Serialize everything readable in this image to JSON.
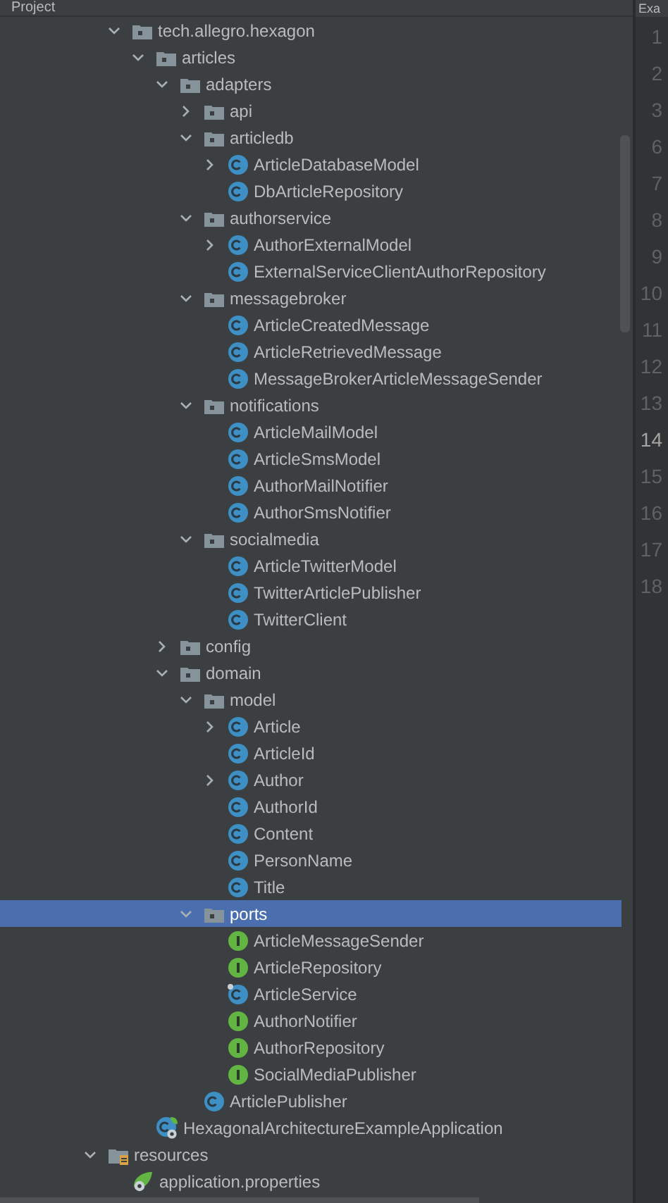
{
  "panel": {
    "title": "Project"
  },
  "editor_tab": {
    "label": "Exa"
  },
  "source_tree": [
    {
      "label": "tech.allegro.hexagon",
      "kind": "package",
      "expanded": true,
      "selected": false,
      "children": [
        {
          "label": "articles",
          "kind": "package",
          "expanded": true,
          "selected": false,
          "children": [
            {
              "label": "adapters",
              "kind": "package",
              "expanded": true,
              "selected": false,
              "children": [
                {
                  "label": "api",
                  "kind": "package",
                  "expanded": false,
                  "selected": false
                },
                {
                  "label": "articledb",
                  "kind": "package",
                  "expanded": true,
                  "selected": false,
                  "children": [
                    {
                      "label": "ArticleDatabaseModel",
                      "kind": "class",
                      "expanded": false,
                      "selected": false
                    },
                    {
                      "label": "DbArticleRepository",
                      "kind": "class",
                      "selected": false
                    }
                  ]
                },
                {
                  "label": "authorservice",
                  "kind": "package",
                  "expanded": true,
                  "selected": false,
                  "children": [
                    {
                      "label": "AuthorExternalModel",
                      "kind": "class",
                      "expanded": false,
                      "selected": false
                    },
                    {
                      "label": "ExternalServiceClientAuthorRepository",
                      "kind": "class",
                      "selected": false
                    }
                  ]
                },
                {
                  "label": "messagebroker",
                  "kind": "package",
                  "expanded": true,
                  "selected": false,
                  "children": [
                    {
                      "label": "ArticleCreatedMessage",
                      "kind": "class",
                      "selected": false
                    },
                    {
                      "label": "ArticleRetrievedMessage",
                      "kind": "class",
                      "selected": false
                    },
                    {
                      "label": "MessageBrokerArticleMessageSender",
                      "kind": "class",
                      "selected": false
                    }
                  ]
                },
                {
                  "label": "notifications",
                  "kind": "package",
                  "expanded": true,
                  "selected": false,
                  "children": [
                    {
                      "label": "ArticleMailModel",
                      "kind": "class",
                      "selected": false
                    },
                    {
                      "label": "ArticleSmsModel",
                      "kind": "class",
                      "selected": false
                    },
                    {
                      "label": "AuthorMailNotifier",
                      "kind": "class",
                      "selected": false
                    },
                    {
                      "label": "AuthorSmsNotifier",
                      "kind": "class",
                      "selected": false
                    }
                  ]
                },
                {
                  "label": "socialmedia",
                  "kind": "package",
                  "expanded": true,
                  "selected": false,
                  "children": [
                    {
                      "label": "ArticleTwitterModel",
                      "kind": "class",
                      "selected": false
                    },
                    {
                      "label": "TwitterArticlePublisher",
                      "kind": "class",
                      "selected": false
                    },
                    {
                      "label": "TwitterClient",
                      "kind": "class",
                      "selected": false
                    }
                  ]
                }
              ]
            },
            {
              "label": "config",
              "kind": "package",
              "expanded": false,
              "selected": false
            },
            {
              "label": "domain",
              "kind": "package",
              "expanded": true,
              "selected": false,
              "children": [
                {
                  "label": "model",
                  "kind": "package",
                  "expanded": true,
                  "selected": false,
                  "children": [
                    {
                      "label": "Article",
                      "kind": "class",
                      "expanded": false,
                      "selected": false
                    },
                    {
                      "label": "ArticleId",
                      "kind": "class",
                      "selected": false
                    },
                    {
                      "label": "Author",
                      "kind": "class",
                      "expanded": false,
                      "selected": false
                    },
                    {
                      "label": "AuthorId",
                      "kind": "class",
                      "selected": false
                    },
                    {
                      "label": "Content",
                      "kind": "class",
                      "selected": false
                    },
                    {
                      "label": "PersonName",
                      "kind": "class",
                      "selected": false
                    },
                    {
                      "label": "Title",
                      "kind": "class",
                      "selected": false
                    }
                  ]
                },
                {
                  "label": "ports",
                  "kind": "package",
                  "expanded": true,
                  "selected": true,
                  "children": [
                    {
                      "label": "ArticleMessageSender",
                      "kind": "interface",
                      "selected": false
                    },
                    {
                      "label": "ArticleRepository",
                      "kind": "interface",
                      "selected": false
                    },
                    {
                      "label": "ArticleService",
                      "kind": "class_marked",
                      "selected": false
                    },
                    {
                      "label": "AuthorNotifier",
                      "kind": "interface",
                      "selected": false
                    },
                    {
                      "label": "AuthorRepository",
                      "kind": "interface",
                      "selected": false
                    },
                    {
                      "label": "SocialMediaPublisher",
                      "kind": "interface",
                      "selected": false
                    }
                  ]
                },
                {
                  "label": "ArticlePublisher",
                  "kind": "class",
                  "selected": false
                }
              ]
            }
          ]
        },
        {
          "label": "HexagonalArchitectureExampleApplication",
          "kind": "spring_app",
          "selected": false
        }
      ]
    }
  ],
  "resources_tree": [
    {
      "label": "resources",
      "kind": "resources_folder",
      "expanded": true,
      "selected": false,
      "children": [
        {
          "label": "application.properties",
          "kind": "properties",
          "selected": false
        }
      ]
    }
  ],
  "gutter": [
    {
      "number": "1",
      "current": false
    },
    {
      "number": "2",
      "current": false
    },
    {
      "number": "3",
      "current": false
    },
    {
      "number": "6",
      "current": false
    },
    {
      "number": "7",
      "current": false
    },
    {
      "number": "8",
      "current": false
    },
    {
      "number": "9",
      "current": false
    },
    {
      "number": "10",
      "current": false
    },
    {
      "number": "11",
      "current": false
    },
    {
      "number": "12",
      "current": false
    },
    {
      "number": "13",
      "current": false
    },
    {
      "number": "14",
      "current": true
    },
    {
      "number": "15",
      "current": false
    },
    {
      "number": "16",
      "current": false
    },
    {
      "number": "17",
      "current": false
    },
    {
      "number": "18",
      "current": false
    }
  ]
}
